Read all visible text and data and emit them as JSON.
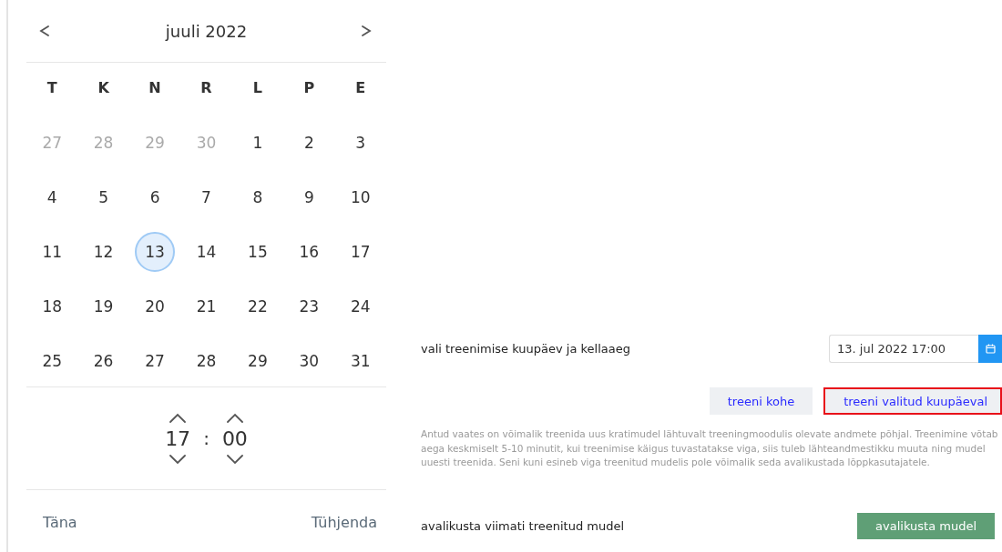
{
  "calendar": {
    "month": "juuli 2022",
    "weekdays": [
      "T",
      "K",
      "N",
      "R",
      "L",
      "P",
      "E"
    ],
    "days": [
      {
        "label": "27",
        "outside": true,
        "selected": false
      },
      {
        "label": "28",
        "outside": true,
        "selected": false
      },
      {
        "label": "29",
        "outside": true,
        "selected": false
      },
      {
        "label": "30",
        "outside": true,
        "selected": false
      },
      {
        "label": "1",
        "outside": false,
        "selected": false
      },
      {
        "label": "2",
        "outside": false,
        "selected": false
      },
      {
        "label": "3",
        "outside": false,
        "selected": false
      },
      {
        "label": "4",
        "outside": false,
        "selected": false
      },
      {
        "label": "5",
        "outside": false,
        "selected": false
      },
      {
        "label": "6",
        "outside": false,
        "selected": false
      },
      {
        "label": "7",
        "outside": false,
        "selected": false
      },
      {
        "label": "8",
        "outside": false,
        "selected": false
      },
      {
        "label": "9",
        "outside": false,
        "selected": false
      },
      {
        "label": "10",
        "outside": false,
        "selected": false
      },
      {
        "label": "11",
        "outside": false,
        "selected": false
      },
      {
        "label": "12",
        "outside": false,
        "selected": false
      },
      {
        "label": "13",
        "outside": false,
        "selected": true
      },
      {
        "label": "14",
        "outside": false,
        "selected": false
      },
      {
        "label": "15",
        "outside": false,
        "selected": false
      },
      {
        "label": "16",
        "outside": false,
        "selected": false
      },
      {
        "label": "17",
        "outside": false,
        "selected": false
      },
      {
        "label": "18",
        "outside": false,
        "selected": false
      },
      {
        "label": "19",
        "outside": false,
        "selected": false
      },
      {
        "label": "20",
        "outside": false,
        "selected": false
      },
      {
        "label": "21",
        "outside": false,
        "selected": false
      },
      {
        "label": "22",
        "outside": false,
        "selected": false
      },
      {
        "label": "23",
        "outside": false,
        "selected": false
      },
      {
        "label": "24",
        "outside": false,
        "selected": false
      },
      {
        "label": "25",
        "outside": false,
        "selected": false
      },
      {
        "label": "26",
        "outside": false,
        "selected": false
      },
      {
        "label": "27",
        "outside": false,
        "selected": false
      },
      {
        "label": "28",
        "outside": false,
        "selected": false
      },
      {
        "label": "29",
        "outside": false,
        "selected": false
      },
      {
        "label": "30",
        "outside": false,
        "selected": false
      },
      {
        "label": "31",
        "outside": false,
        "selected": false
      }
    ],
    "time": {
      "hours": "17",
      "separator": ":",
      "minutes": "00"
    },
    "footer": {
      "today": "Täna",
      "clear": "Tühjenda"
    }
  },
  "training": {
    "label": "vali treenimise kuupäev ja kellaaeg",
    "date_value": "13. jul 2022 17:00",
    "buttons": [
      {
        "label": "treeni kohe",
        "highlighted": false
      },
      {
        "label": "treeni valitud kuupäeval",
        "highlighted": true
      }
    ],
    "description": "Antud vaates on võimalik treenida uus kratimudel lähtuvalt treeningmoodulis olevate andmete põhjal. Treenimine võtab aega keskmiselt 5-10 minutit, kui treenimise käigus tuvastatakse viga, siis tuleb lähteandmestikku muuta ning mudel uuesti treenida. Seni kuni esineb viga treenitud mudelis pole võimalik seda avalikustada lõppkasutajatele."
  },
  "publish": {
    "label": "avalikusta viimati treenitud mudel",
    "button": "avalikusta mudel"
  }
}
